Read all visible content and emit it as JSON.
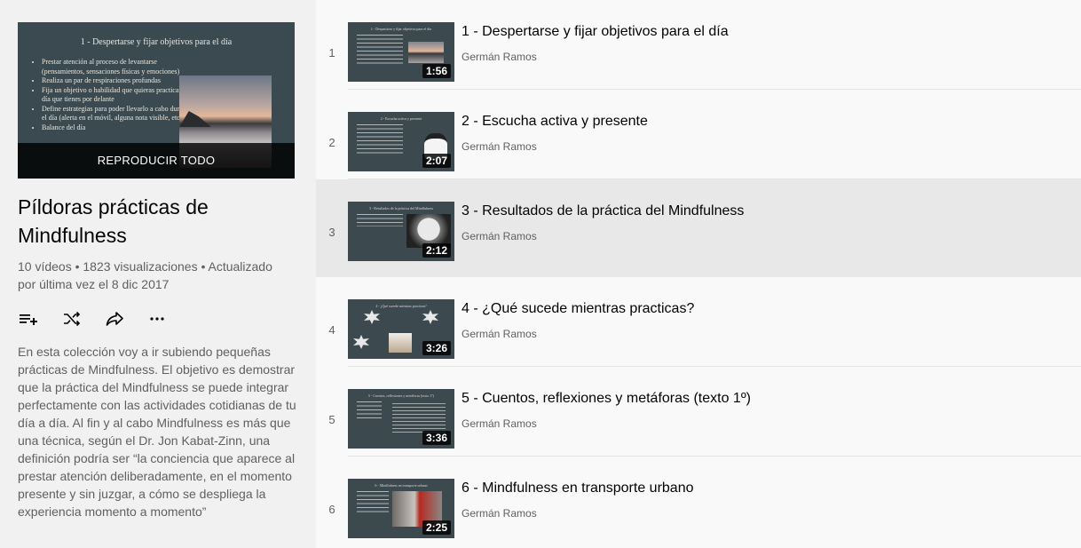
{
  "playlist": {
    "hero": {
      "slide_title": "1 - Despertarse y fijar objetivos para el día",
      "slide_bullets": [
        "Prestar atención al proceso de levantarse (pensamientos, sensaciones físicas y emociones)",
        "Realiza un par de respiraciones profundas",
        "Fija un objetivo o habilidad que quieras practicar en el día que tienes por delante",
        "Define estrategias para poder llevarlo a cabo durante el día (alerta en el móvil, alguna nota visible, etc.)",
        "Balance del día"
      ],
      "play_all_label": "REPRODUCIR TODO"
    },
    "title": "Píldoras prácticas de Mindfulness",
    "stats": "10 vídeos • 1823 visualizaciones • Actualizado por última vez el 8 dic 2017",
    "actions": [
      {
        "name": "add-to-queue-icon"
      },
      {
        "name": "shuffle-icon"
      },
      {
        "name": "share-icon"
      },
      {
        "name": "more-options-icon"
      }
    ],
    "description": "En esta colección voy a ir subiendo pequeñas prácticas de Mindfulness. El objetivo es demostrar que la práctica del Mindfulness se puede integrar perfectamente con las actividades cotidianas de tu día a día. Al fin y al cabo Mindfulness es más que una técnica, según el Dr. Jon Kabat-Zinn, una definición  podría ser “la conciencia que aparece al prestar atención deliberadamente, en el momento presente y sin juzgar, a cómo se despliega la experiencia momento a momento”"
  },
  "videos": [
    {
      "index": "1",
      "title": "1 - Despertarse y fijar objetivos para el día",
      "channel": "Germán Ramos",
      "duration": "1:56"
    },
    {
      "index": "2",
      "title": "2 - Escucha activa y presente",
      "channel": "Germán Ramos",
      "duration": "2:07"
    },
    {
      "index": "3",
      "title": "3 - Resultados de la práctica del Mindfulness",
      "channel": "Germán Ramos",
      "duration": "2:12"
    },
    {
      "index": "4",
      "title": "4 - ¿Qué sucede mientras practicas?",
      "channel": "Germán Ramos",
      "duration": "3:26"
    },
    {
      "index": "5",
      "title": "5 - Cuentos, reflexiones y metáforas (texto 1º)",
      "channel": "Germán Ramos",
      "duration": "3:36"
    },
    {
      "index": "6",
      "title": "6 - Mindfulness en transporte urbano",
      "channel": "Germán Ramos",
      "duration": "2:25"
    }
  ],
  "colors": {
    "sidebar_bg": "#f1f1f1",
    "slide_bg": "#3b4a50",
    "active_row_bg": "#e8e8e8",
    "secondary_text": "#606060"
  }
}
